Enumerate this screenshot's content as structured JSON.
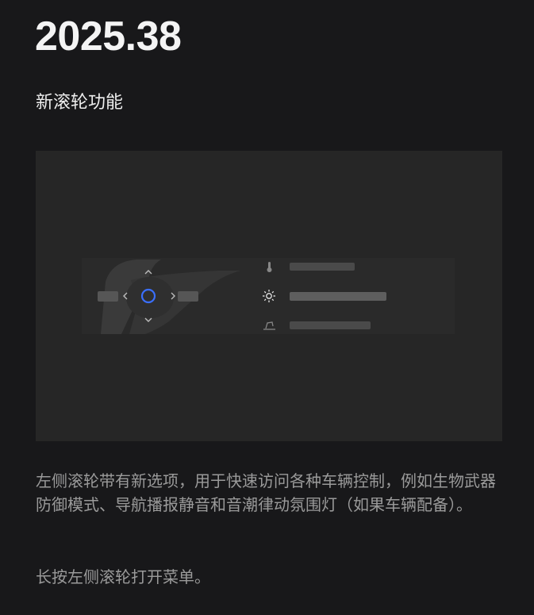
{
  "release": {
    "version": "2025.38"
  },
  "feature": {
    "title": "新滚轮功能",
    "description": "左侧滚轮带有新选项，用于快速访问各种车辆控制，例如生物武器防御模式、导航播报静音和音潮律动氛围灯（如果车辆配备）。",
    "hint": "长按左侧滚轮打开菜单。"
  },
  "illustration": {
    "wheel_icons": [
      "chevron-up-icon",
      "chevron-down-icon",
      "chevron-left-icon",
      "chevron-right-icon",
      "scroll-button-icon"
    ],
    "menu_icons": [
      "thermometer-icon",
      "sun-icon",
      "seat-icon"
    ],
    "colors": {
      "scroll_button_ring": "#3a6fff",
      "panel_background": "#2a2a2a",
      "illustration_background": "#262626"
    }
  }
}
